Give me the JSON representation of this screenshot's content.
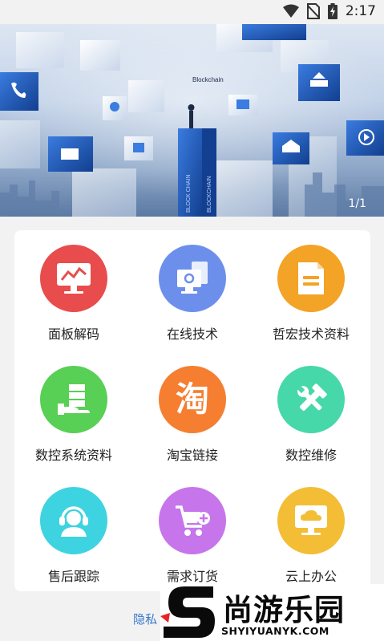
{
  "status_bar": {
    "time": "2:17"
  },
  "banner": {
    "overlay_text": "Blockchain",
    "tower_text_1": "BLOCK CHAIN",
    "tower_text_2": "BLOCKCHAIN",
    "counter": "1/1"
  },
  "grid": {
    "items": [
      {
        "label": "面板解码",
        "color": "#e94c4c",
        "icon": "monitor-chart-icon"
      },
      {
        "label": "在线技术",
        "color": "#6d8fec",
        "icon": "computer-document-icon"
      },
      {
        "label": "哲宏技术资料",
        "color": "#f3a325",
        "icon": "document-icon"
      },
      {
        "label": "数控系统资料",
        "color": "#58cf55",
        "icon": "hand-server-icon"
      },
      {
        "label": "淘宝链接",
        "color": "#f57e31",
        "icon": "taobao-icon",
        "glyph": "淘"
      },
      {
        "label": "数控维修",
        "color": "#46d8a8",
        "icon": "tools-icon"
      },
      {
        "label": "售后跟踪",
        "color": "#3ed3e0",
        "icon": "headset-agent-icon"
      },
      {
        "label": "需求订货",
        "color": "#c676ea",
        "icon": "shopping-cart-add-icon"
      },
      {
        "label": "云上办公",
        "color": "#f3be36",
        "icon": "cloud-monitor-icon"
      }
    ]
  },
  "footer": {
    "privacy_link": "隐私"
  },
  "watermark": {
    "name": "尚游乐园",
    "url": "SHYIYUANYK.COM"
  }
}
